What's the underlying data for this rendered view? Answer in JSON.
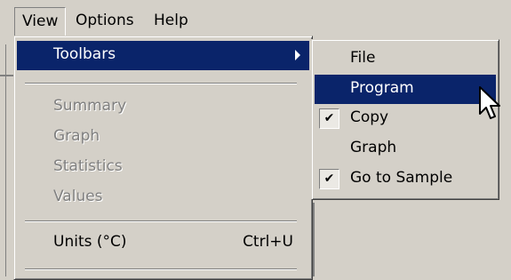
{
  "menubar": {
    "items": [
      {
        "label": "View"
      },
      {
        "label": "Options"
      },
      {
        "label": "Help"
      }
    ]
  },
  "view_menu": {
    "toolbars": {
      "label": "Toolbars"
    },
    "summary": {
      "label": "Summary",
      "enabled": false
    },
    "graph": {
      "label": "Graph",
      "enabled": false
    },
    "statistics": {
      "label": "Statistics",
      "enabled": false
    },
    "values": {
      "label": "Values",
      "enabled": false
    },
    "units": {
      "label": "Units (°C)",
      "shortcut": "Ctrl+U"
    }
  },
  "toolbars_submenu": {
    "items": [
      {
        "label": "File",
        "checked": false
      },
      {
        "label": "Program",
        "checked": false,
        "highlighted": true
      },
      {
        "label": "Copy",
        "checked": true
      },
      {
        "label": "Graph",
        "checked": false
      },
      {
        "label": "Go to Sample",
        "checked": true
      }
    ]
  },
  "colors": {
    "face": "#d4d0c8",
    "highlight": "#0a246a",
    "disabled_text": "#808080"
  },
  "icons": {
    "submenu_arrow": "triangle-right",
    "check": "checkmark",
    "cursor": "arrow-pointer"
  }
}
